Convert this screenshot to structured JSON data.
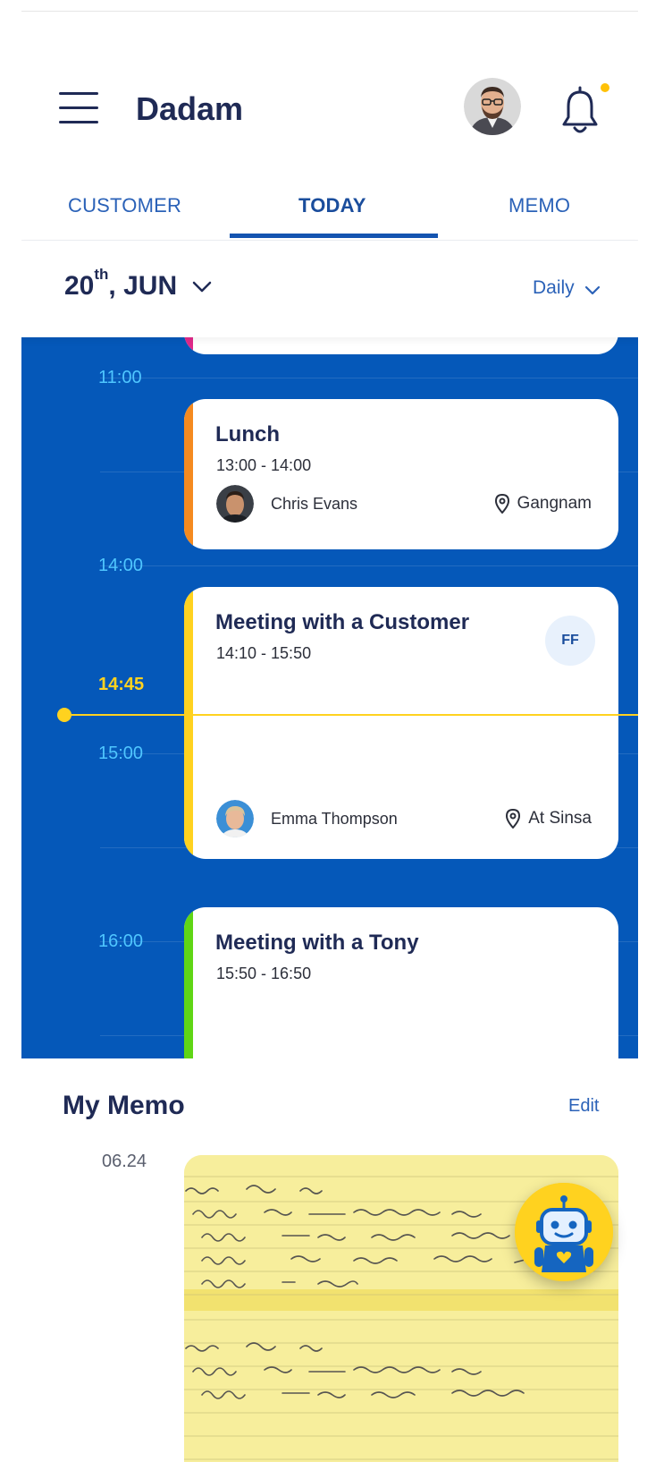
{
  "header": {
    "app_title": "Dadam",
    "notification_dot_color": "#ffc107"
  },
  "tabs": [
    {
      "label": "CUSTOMER",
      "active": false
    },
    {
      "label": "TODAY",
      "active": true
    },
    {
      "label": "MEMO",
      "active": false
    }
  ],
  "date_bar": {
    "day": "20",
    "day_suffix": "th",
    "month": ", JUN",
    "view": "Daily"
  },
  "timeline": {
    "times": [
      "11:00",
      "14:00",
      "14:45",
      "15:00",
      "16:00"
    ],
    "current_time": "14:45",
    "events": [
      {
        "title": "Lunch",
        "time": "13:00 - 14:00",
        "person": "Chris Evans",
        "location": "Gangnam",
        "color": "#f58a1f"
      },
      {
        "title": "Meeting with a Customer",
        "time": "14:10 - 15:50",
        "person": "Emma Thompson",
        "location": "At Sinsa",
        "badge": "FF",
        "color": "#ffd21f"
      },
      {
        "title": "Meeting with a Tony",
        "time": "15:50 - 16:50",
        "color": "#5fd615"
      }
    ]
  },
  "memo": {
    "title": "My Memo",
    "edit_label": "Edit",
    "items": [
      {
        "date": "06.24"
      }
    ]
  },
  "icons": [
    "menu-icon",
    "bell-icon",
    "chevron-down-icon",
    "location-pin-icon",
    "robot-assistant-icon"
  ]
}
